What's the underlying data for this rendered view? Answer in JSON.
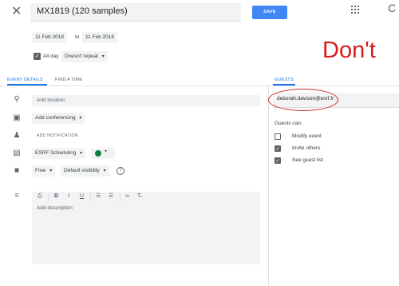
{
  "header": {
    "title": "MX1819 (120 samples)",
    "save_label": "SAVE",
    "top_right_fragment": "C"
  },
  "dates": {
    "start": "11 Feb 2018",
    "to": "to",
    "end": "11 Feb 2018",
    "all_day_label": "All day",
    "all_day_checked": true,
    "repeat": "Doesn't repeat"
  },
  "annotation": {
    "overlay_text": "Don't"
  },
  "tabs": {
    "event_details": "EVENT DETAILS",
    "find_a_time": "FIND A TIME",
    "guests": "GUESTS"
  },
  "details": {
    "location_placeholder": "Add location",
    "conferencing": "Add conferencing",
    "notification": "ADD NOTIFICATION",
    "calendar": "ESRF Scheduling",
    "calendar_color": "#0b8043",
    "availability": "Free",
    "visibility": "Default visibility",
    "description_placeholder": "Add description"
  },
  "guests": {
    "guest_email": "deborah.davison@esrf.fr",
    "guests_can_label": "Guests can:",
    "permissions": [
      {
        "label": "Modify event",
        "checked": false
      },
      {
        "label": "Invite others",
        "checked": true
      },
      {
        "label": "See guest list",
        "checked": true
      }
    ]
  },
  "colors": {
    "accent": "#1a73e8",
    "save_button": "#4285f4",
    "annotation_red": "#d51b1b"
  }
}
